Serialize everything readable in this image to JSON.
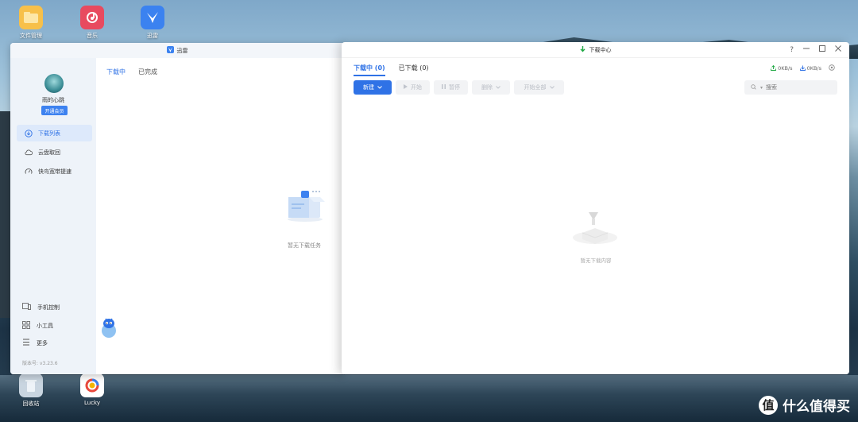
{
  "desktop": {
    "icons": [
      {
        "label": "文件管理",
        "color": "#f6b93b"
      },
      {
        "label": "音乐",
        "color": "#e84a5f"
      },
      {
        "label": "迅雷",
        "color": "#3b82f0"
      },
      {
        "label": "回收站",
        "color": "#dfe6ee"
      },
      {
        "label": "Lucky",
        "color": "#ffffff"
      }
    ],
    "watermark": "什么值得买"
  },
  "thunder": {
    "title": "迅雷",
    "username": "雨的心跳",
    "vip_label": "开通会员",
    "nav": [
      {
        "label": "下载列表",
        "icon": "download-circle-icon",
        "active": true
      },
      {
        "label": "云盘取回",
        "icon": "cloud-icon",
        "active": false
      },
      {
        "label": "快鸟宽带提速",
        "icon": "speedometer-icon",
        "active": false
      }
    ],
    "bottom": [
      {
        "label": "手机控制",
        "icon": "phone-icon"
      },
      {
        "label": "小工具",
        "icon": "grid-icon"
      },
      {
        "label": "更多",
        "icon": "menu-icon"
      }
    ],
    "version": "版本号: v3.23.6",
    "tabs": [
      {
        "label": "下载中",
        "active": true
      },
      {
        "label": "已完成",
        "active": false
      }
    ],
    "empty_text": "暂无下载任务"
  },
  "download_center": {
    "title": "下载中心",
    "tabs": [
      {
        "label": "下载中 (0)",
        "active": true
      },
      {
        "label": "已下载 (0)",
        "active": false
      }
    ],
    "upload_speed": "0KB/s",
    "download_speed": "0KB/s",
    "toolbar": {
      "new": "新建",
      "start": "开始",
      "pause": "暂停",
      "delete": "删除",
      "start_all": "开始全部"
    },
    "search_placeholder": "搜索",
    "empty_text": "暂无下载内容",
    "accent": "#2f72e6"
  }
}
